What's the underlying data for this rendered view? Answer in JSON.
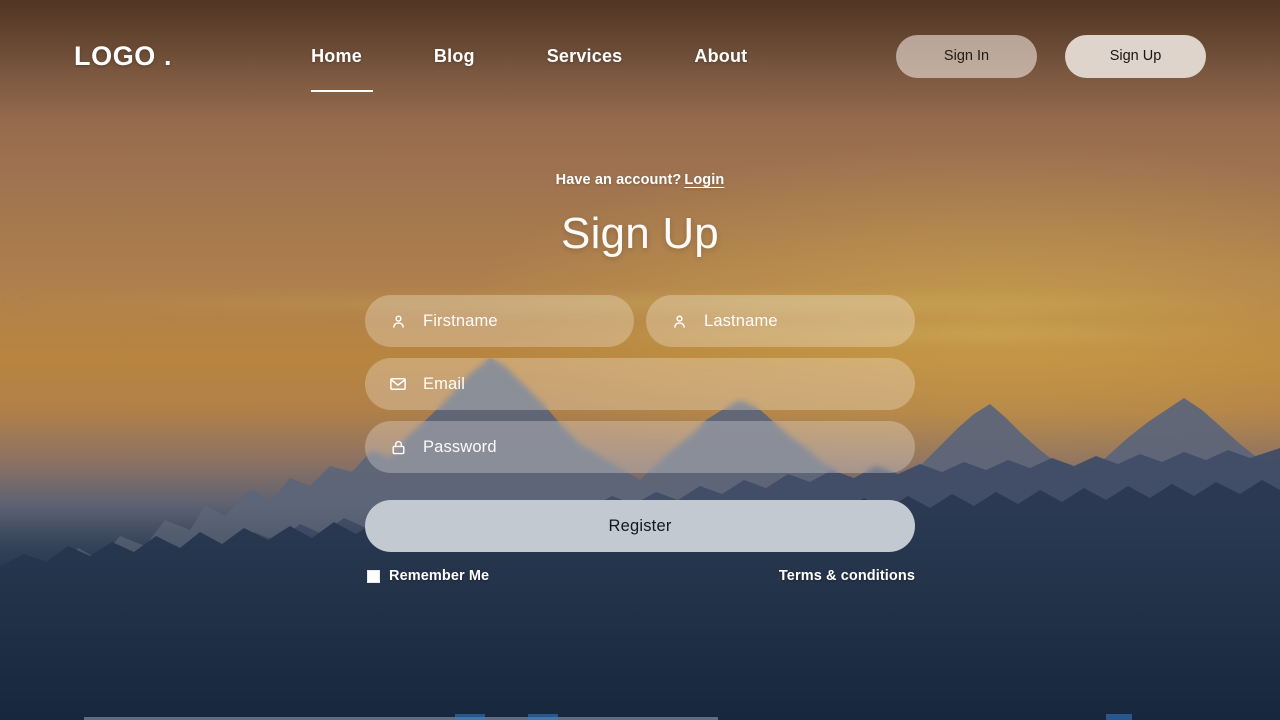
{
  "header": {
    "logo": "LOGO .",
    "nav": [
      {
        "label": "Home",
        "active": true
      },
      {
        "label": "Blog",
        "active": false
      },
      {
        "label": "Services",
        "active": false
      },
      {
        "label": "About",
        "active": false
      }
    ],
    "sign_in_label": "Sign In",
    "sign_up_label": "Sign Up"
  },
  "form": {
    "have_account_text": "Have an account?",
    "login_link": "Login",
    "title": "Sign Up",
    "fields": [
      {
        "name": "firstname",
        "placeholder": "Firstname",
        "icon": "user-icon"
      },
      {
        "name": "lastname",
        "placeholder": "Lastname",
        "icon": "user-icon"
      },
      {
        "name": "email",
        "placeholder": "Email",
        "icon": "envelope-icon"
      },
      {
        "name": "password",
        "placeholder": "Password",
        "icon": "lock-icon"
      }
    ],
    "submit_label": "Register",
    "remember_label": "Remember Me",
    "remember_checked": false,
    "terms_label": "Terms & conditions"
  },
  "theme": {
    "sky_top": "#6b4a33",
    "sky_amber": "#b8853f",
    "sky_bottom": "#16273c",
    "mountain_far": "#5d6578",
    "mountain_mid": "#414d66",
    "mountain_near": "#2b3a52",
    "button_primary": "#c3c9d1",
    "sign_up_bg": "#ded4cb",
    "text_on_dark": "#ffffff"
  }
}
